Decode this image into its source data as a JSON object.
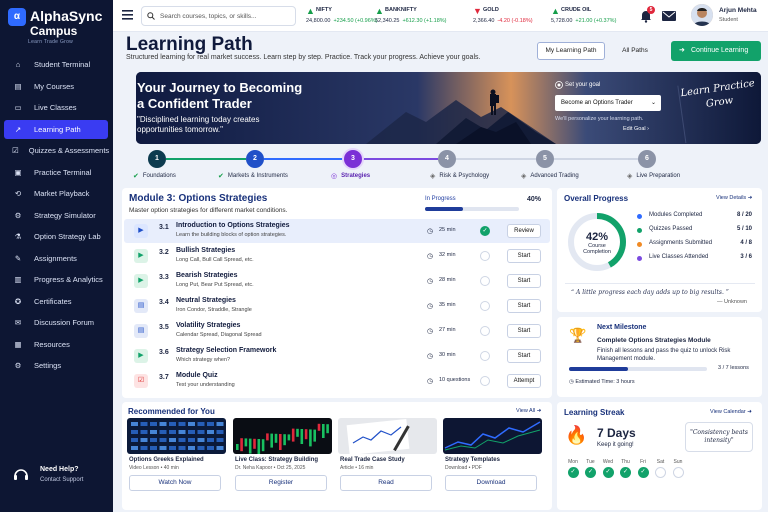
{
  "brand": {
    "name": "AlphaSync",
    "sub": "Campus",
    "tagline": "Learn   Trade   Grow",
    "logo": "α"
  },
  "sidebar": {
    "items": [
      {
        "label": "Student Terminal",
        "icon": "home-icon"
      },
      {
        "label": "My Courses",
        "icon": "book-icon"
      },
      {
        "label": "Live Classes",
        "icon": "video-icon"
      },
      {
        "label": "Learning Path",
        "icon": "trend-icon",
        "active": true
      },
      {
        "label": "Quizzes & Assessments",
        "icon": "quiz-icon"
      },
      {
        "label": "Practice Terminal",
        "icon": "terminal-icon"
      },
      {
        "label": "Market Playback",
        "icon": "playback-icon"
      },
      {
        "label": "Strategy Simulator",
        "icon": "simulator-icon"
      },
      {
        "label": "Option Strategy Lab",
        "icon": "lab-icon"
      },
      {
        "label": "Assignments",
        "icon": "assignment-icon"
      },
      {
        "label": "Progress & Analytics",
        "icon": "analytics-icon"
      },
      {
        "label": "Certificates",
        "icon": "certificate-icon"
      },
      {
        "label": "Discussion Forum",
        "icon": "forum-icon"
      },
      {
        "label": "Resources",
        "icon": "resources-icon"
      },
      {
        "label": "Settings",
        "icon": "gear-icon"
      }
    ],
    "help": {
      "title": "Need Help?",
      "sub": "Contact Support"
    }
  },
  "topbar": {
    "search_placeholder": "Search courses, topics, or skills...",
    "tickers": [
      {
        "name": "NIFTY",
        "value": "24,800.00",
        "change": "+234.50 (+0.96%)",
        "dir": "up"
      },
      {
        "name": "BANKNIFTY",
        "value": "52,340.25",
        "change": "+612.30 (+1.18%)",
        "dir": "up"
      },
      {
        "name": "GOLD",
        "value": "2,366.40",
        "change": "-4.20 (-0.18%)",
        "dir": "down"
      },
      {
        "name": "CRUDE OIL",
        "value": "5,728.00",
        "change": "+21.00 (+0.37%)",
        "dir": "up"
      }
    ],
    "notifications": "5",
    "user": {
      "name": "Arjun Mehta",
      "role": "Student"
    }
  },
  "header": {
    "title": "Learning Path",
    "subtitle": "Structured learning for real market success. Learn step by step. Practice. Track your progress. Achieve your goals.",
    "btn_my": "My Learning Path",
    "btn_all": "All Paths",
    "btn_continue": "Continue Learning"
  },
  "hero": {
    "line1": "Your Journey to Becoming",
    "line2": "a Confident Trader",
    "quote": "\"Disciplined learning today creates opportunities tomorrow.\"",
    "goal_label": "Set your goal",
    "goal_value": "Become an Options Trader",
    "personalize": "We'll personalize your learning path.",
    "edit_goal": "Edit Goal",
    "script": "Learn Practice Grow"
  },
  "steps": [
    {
      "n": "1",
      "label": "Foundations",
      "state": "done"
    },
    {
      "n": "2",
      "label": "Markets & Instruments",
      "state": "done"
    },
    {
      "n": "3",
      "label": "Strategies",
      "state": "current"
    },
    {
      "n": "4",
      "label": "Risk & Psychology",
      "state": "todo"
    },
    {
      "n": "5",
      "label": "Advanced Trading",
      "state": "todo"
    },
    {
      "n": "6",
      "label": "Live Preparation",
      "state": "todo"
    }
  ],
  "module": {
    "title": "Module 3: Options Strategies",
    "subtitle": "Master option strategies for different market conditions.",
    "status": "In Progress",
    "percent": "40%",
    "progress": 0.4,
    "lessons": [
      {
        "num": "3.1",
        "title": "Introduction to Options Strategies",
        "sub": "Learn the building blocks of option strategies.",
        "dur": "25 min",
        "done": true,
        "btn": "Review",
        "icon": "play",
        "hl": true
      },
      {
        "num": "3.2",
        "title": "Bullish Strategies",
        "sub": "Long Call, Bull Call Spread, etc.",
        "dur": "32 min",
        "done": false,
        "btn": "Start",
        "icon": "play"
      },
      {
        "num": "3.3",
        "title": "Bearish Strategies",
        "sub": "Long Put, Bear Put Spread, etc.",
        "dur": "28 min",
        "done": false,
        "btn": "Start",
        "icon": "play"
      },
      {
        "num": "3.4",
        "title": "Neutral Strategies",
        "sub": "Iron Condor, Straddle, Strangle",
        "dur": "35 min",
        "done": false,
        "btn": "Start",
        "icon": "doc"
      },
      {
        "num": "3.5",
        "title": "Volatility Strategies",
        "sub": "Calendar Spread, Diagonal Spread",
        "dur": "27 min",
        "done": false,
        "btn": "Start",
        "icon": "doc"
      },
      {
        "num": "3.6",
        "title": "Strategy Selection Framework",
        "sub": "Which strategy when?",
        "dur": "30 min",
        "done": false,
        "btn": "Start",
        "icon": "play"
      },
      {
        "num": "3.7",
        "title": "Module Quiz",
        "sub": "Test your understanding",
        "dur": "10 questions",
        "done": false,
        "btn": "Attempt",
        "icon": "quiz"
      }
    ]
  },
  "overall": {
    "title": "Overall Progress",
    "view": "View Details",
    "percent": "42%",
    "pct": 0.42,
    "label1": "Course",
    "label2": "Completion",
    "stats": [
      {
        "label": "Modules Completed",
        "value": "8 / 20",
        "color": "#2f6bff"
      },
      {
        "label": "Quizzes Passed",
        "value": "5 / 10",
        "color": "#12a26a"
      },
      {
        "label": "Assignments Submitted",
        "value": "4 / 8",
        "color": "#f08a24"
      },
      {
        "label": "Live Classes Attended",
        "value": "3 / 6",
        "color": "#7b4ae0"
      }
    ],
    "quote": "A little progress each day adds up to big results.",
    "quote_author": "— Unknown"
  },
  "milestone": {
    "title": "Next Milestone",
    "name": "Complete Options Strategies Module",
    "desc": "Finish all lessons and pass the quiz to unlock Risk Management module.",
    "progress_label": "3 / 7 lessons",
    "progress": 0.43,
    "estimate": "Estimated Time:  3 hours"
  },
  "recommended": {
    "title": "Recommended for You",
    "view": "View All",
    "items": [
      {
        "title": "Options Greeks Explained",
        "meta": "Video Lesson • 40 min",
        "btn": "Watch Now"
      },
      {
        "title": "Live Class: Strategy Building",
        "meta": "Dr. Neha Kapoor • Oct 25, 2025",
        "btn": "Register"
      },
      {
        "title": "Real Trade Case Study",
        "meta": "Article • 16 min",
        "btn": "Read"
      },
      {
        "title": "Strategy Templates",
        "meta": "Download • PDF",
        "btn": "Download"
      }
    ]
  },
  "streak": {
    "title": "Learning Streak",
    "view": "View Calendar",
    "days": "7 Days",
    "sub": "Keep it going!",
    "quote": "\"Consistency beats intensity\"",
    "week": [
      {
        "d": "Mon",
        "on": true
      },
      {
        "d": "Tue",
        "on": true
      },
      {
        "d": "Wed",
        "on": true
      },
      {
        "d": "Thu",
        "on": true
      },
      {
        "d": "Fri",
        "on": true
      },
      {
        "d": "Sat",
        "on": false
      },
      {
        "d": "Sun",
        "on": false
      }
    ]
  }
}
